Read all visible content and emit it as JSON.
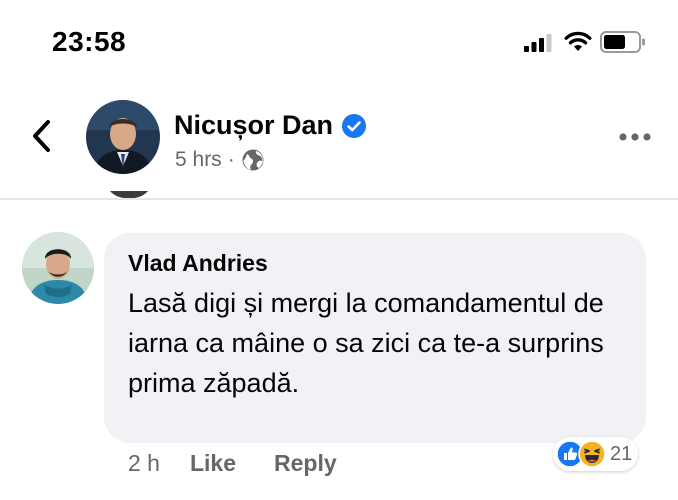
{
  "status_bar": {
    "time": "23:58"
  },
  "post": {
    "author_name": "Nicușor Dan",
    "time_ago": "5 hrs",
    "separator": "·",
    "privacy_icon": "globe-icon",
    "verified_icon": "verified-badge-icon"
  },
  "comment": {
    "author_name": "Vlad Andries",
    "text": "Lasă digi și mergi la comandamentul de iarna ca mâine o sa zici ca te-a surprins prima zăpadă.",
    "time_ago": "2 h",
    "like_label": "Like",
    "reply_label": "Reply",
    "reactions": {
      "icons": [
        "like-reaction-icon",
        "haha-reaction-icon"
      ],
      "count": "21"
    }
  },
  "colors": {
    "accent": "#1877f2",
    "bubble_bg": "#f0f2f5",
    "secondary_text": "#65676b"
  }
}
